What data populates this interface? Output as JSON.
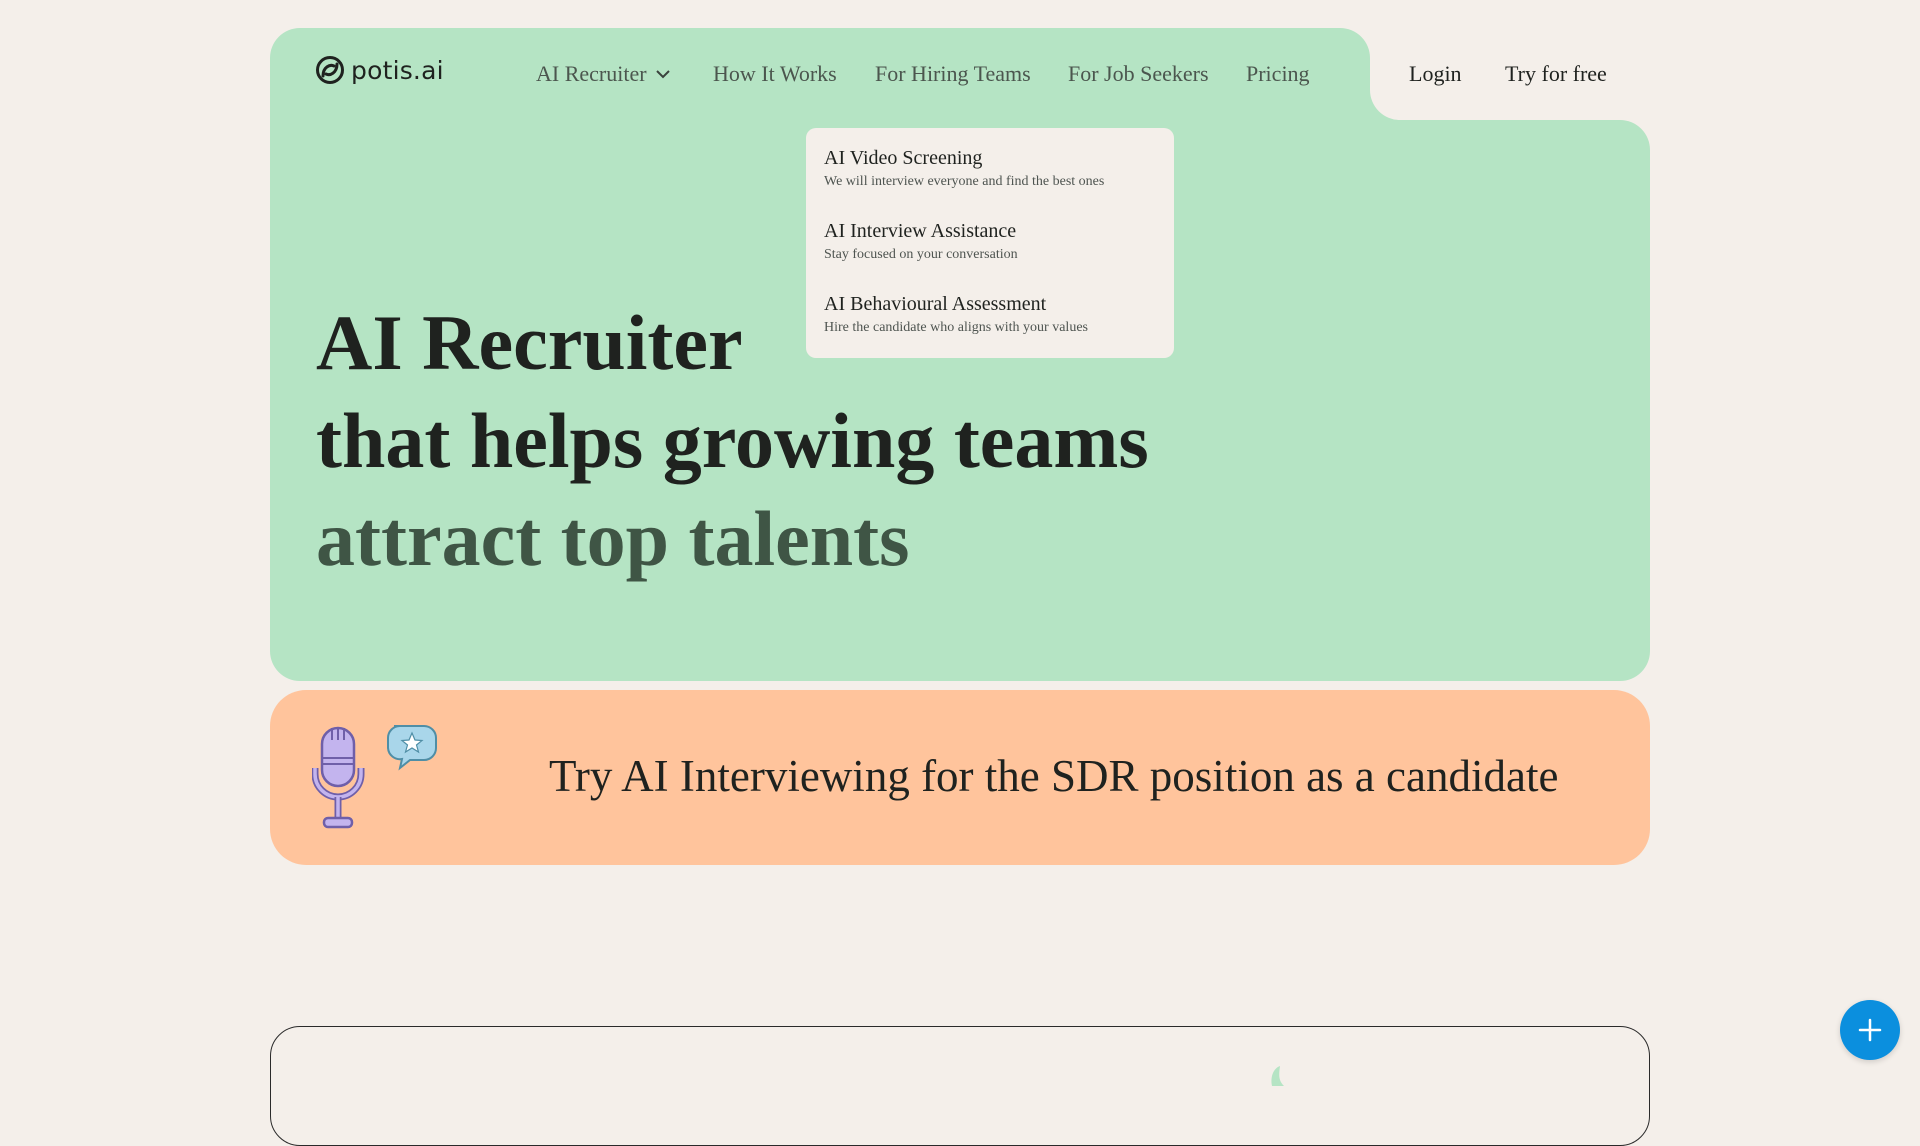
{
  "brand": {
    "name": "potis.ai"
  },
  "nav": {
    "items": [
      {
        "label": "AI Recruiter",
        "has_dropdown": true
      },
      {
        "label": "How It Works"
      },
      {
        "label": "For Hiring Teams"
      },
      {
        "label": "For Job Seekers"
      },
      {
        "label": "Pricing"
      }
    ],
    "login_label": "Login",
    "try_label": "Try for free"
  },
  "dropdown": {
    "items": [
      {
        "title": "AI Video Screening",
        "desc": "We will interview everyone and find the best ones"
      },
      {
        "title": "AI Interview Assistance",
        "desc": "Stay focused on your conversation"
      },
      {
        "title": "AI Behavioural Assessment",
        "desc": "Hire the candidate who aligns with your values"
      }
    ]
  },
  "hero": {
    "line1": "AI Recruiter",
    "line2": "that helps growing teams",
    "line3": "attract top talents"
  },
  "banner": {
    "text": "Try AI Interviewing for the SDR position as a candidate",
    "icon": "microphone-icon"
  },
  "fab": {
    "icon": "plus-icon"
  },
  "colors": {
    "page_bg": "#f4efea",
    "hero_bg": "#b5e4c4",
    "banner_bg": "#ffc49c",
    "fab_bg": "#0b8fde",
    "text_dark": "#1f221f",
    "text_green": "#3f5545"
  }
}
